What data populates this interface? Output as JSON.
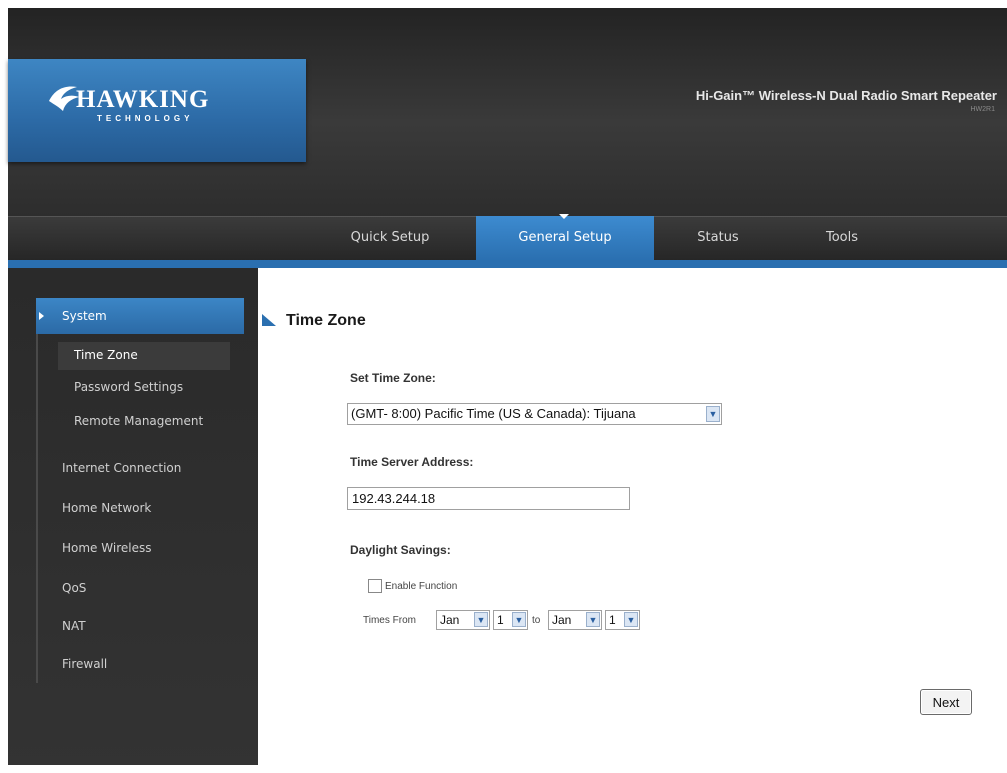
{
  "brand": {
    "logo_name": "HAWKING",
    "logo_tagline": "TECHNOLOGY",
    "product_title": "Hi-Gain™ Wireless-N Dual Radio Smart Repeater",
    "product_model": "HW2R1"
  },
  "nav": {
    "tabs": [
      {
        "label": "Quick Setup",
        "active": false
      },
      {
        "label": "General Setup",
        "active": true
      },
      {
        "label": "Status",
        "active": false
      },
      {
        "label": "Tools",
        "active": false
      }
    ]
  },
  "sidebar": {
    "items": [
      {
        "label": "System",
        "active": true
      },
      {
        "label": "Time Zone",
        "active": true
      },
      {
        "label": "Password Settings",
        "active": false
      },
      {
        "label": "Remote Management",
        "active": false
      },
      {
        "label": "Internet Connection",
        "active": false
      },
      {
        "label": "Home Network",
        "active": false
      },
      {
        "label": "Home Wireless",
        "active": false
      },
      {
        "label": "QoS",
        "active": false
      },
      {
        "label": "NAT",
        "active": false
      },
      {
        "label": "Firewall",
        "active": false
      }
    ]
  },
  "main": {
    "title": "Time Zone",
    "time_zone_label": "Set Time Zone:",
    "time_zone_value": "(GMT- 8:00) Pacific Time (US & Canada): Tijuana",
    "server_label": "Time Server Address:",
    "server_value": "192.43.244.18",
    "daylight_label": "Daylight Savings:",
    "enable_label": "Enable Function",
    "enable_checked": false,
    "times_from_label": "Times From",
    "to_label": "to",
    "from_month": "Jan",
    "from_day": "1",
    "to_month": "Jan",
    "to_day": "1",
    "next_label": "Next"
  },
  "colors": {
    "accent": "#2a6fb0",
    "header_dark": "#2d2d2d",
    "sidebar_dark": "#2f2f2f"
  },
  "icons": {
    "logo": "hawk-wing-icon",
    "nav_caret": "caret-down-icon",
    "sidebar_arrow": "triangle-right-icon",
    "title_marker": "triangle-corner-icon",
    "dropdown": "chevron-down-icon"
  }
}
